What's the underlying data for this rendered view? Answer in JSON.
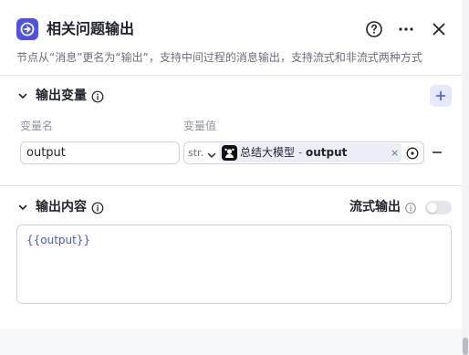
{
  "header": {
    "title": "相关问题输出",
    "description": "节点从“消息”更名为“输出”，支持中间过程的消息输出，支持流式和非流式两种方式",
    "icons": [
      "node-output-icon",
      "help-icon",
      "more-icon",
      "close-icon"
    ]
  },
  "output_vars": {
    "title": "输出变量",
    "col_name": "变量名",
    "col_value": "变量值",
    "rows": [
      {
        "name": "output",
        "type": "str.",
        "ref_node": "总结大模型",
        "ref_sep": " - ",
        "ref_var": "output",
        "ref_close": "×"
      }
    ]
  },
  "output_content": {
    "title": "输出内容",
    "stream_label": "流式输出",
    "stream_enabled": false,
    "content": "{{output}}"
  },
  "colors": {
    "accent": "#4d53e8",
    "accent_light": "#e6e8fc",
    "border": "#d0d3d9",
    "muted": "#8f959e"
  }
}
